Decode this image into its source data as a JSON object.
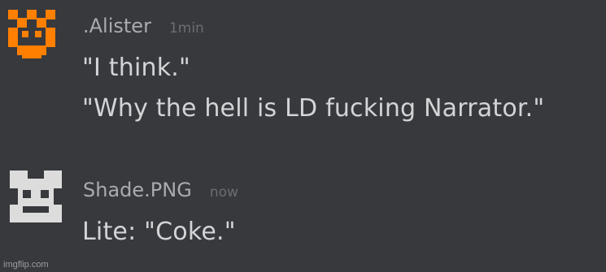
{
  "messages": [
    {
      "username": ".Alister",
      "timestamp": "1min",
      "avatar_icon": "orange-pixel-face-icon",
      "avatar_color": "#ff7f00",
      "lines": [
        "\"I think.\"",
        "\"Why the hell is LD fucking Narrator.\""
      ]
    },
    {
      "username": "Shade.PNG",
      "timestamp": "now",
      "avatar_icon": "white-pixel-face-icon",
      "avatar_color": "#dcdcdc",
      "lines": [
        "Lite: \"Coke.\""
      ]
    }
  ],
  "watermark": "imgflip.com",
  "colors": {
    "background": "#37393d",
    "username": "#a9abae",
    "timestamp": "#6c6e72",
    "message_text": "#d3d4d6"
  }
}
